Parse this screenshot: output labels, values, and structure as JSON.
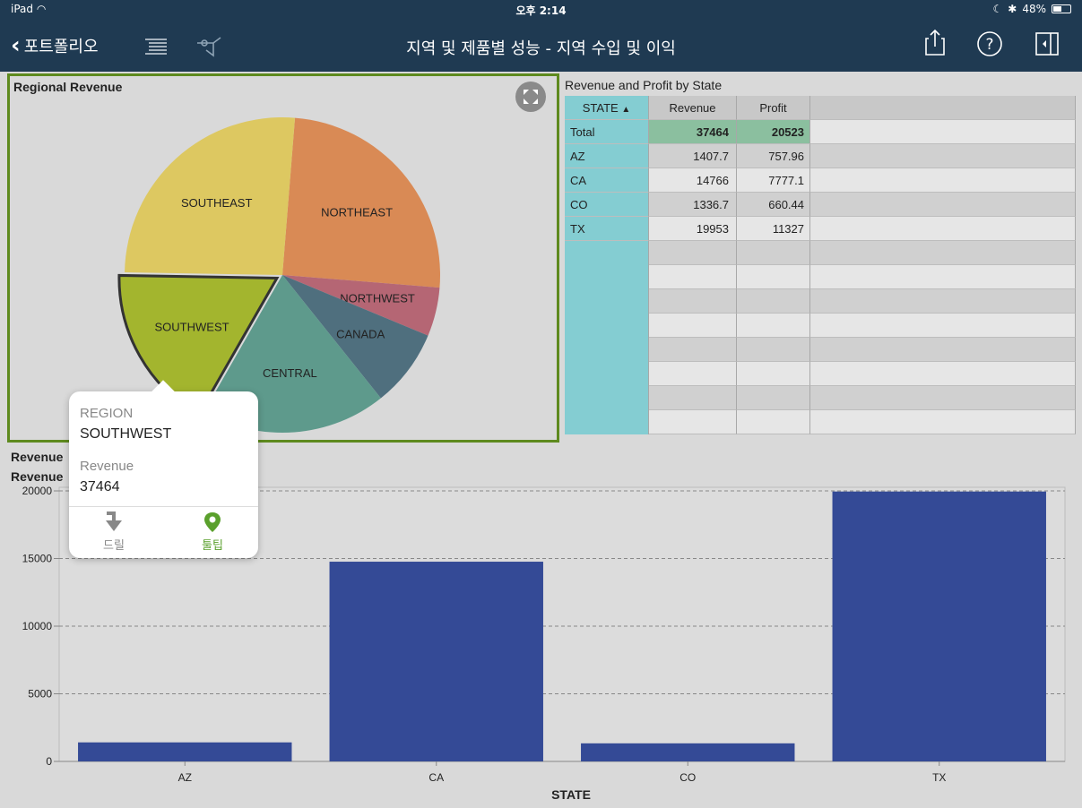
{
  "status_bar": {
    "device": "iPad",
    "time": "오후 2:14",
    "battery": "48%"
  },
  "nav": {
    "back_label": "포트폴리오",
    "title": "지역 및 제품별 성능 - 지역 수입 및 이익"
  },
  "pie_panel": {
    "title": "Regional Revenue",
    "chart_data": {
      "type": "pie",
      "title": "Regional Revenue",
      "slices": [
        {
          "label": "NORTHEAST",
          "value": 25,
          "color": "#d98a55"
        },
        {
          "label": "NORTHWEST",
          "value": 5,
          "color": "#b56674"
        },
        {
          "label": "CANADA",
          "value": 8,
          "color": "#4f6f7e"
        },
        {
          "label": "CENTRAL",
          "value": 19,
          "color": "#5e9a8c"
        },
        {
          "label": "SOUTHWEST",
          "value": 17,
          "color": "#a3b52e"
        },
        {
          "label": "SOUTHEAST",
          "value": 26,
          "color": "#ddc861"
        }
      ],
      "highlighted": "SOUTHWEST"
    }
  },
  "table_panel": {
    "title": "Revenue and Profit by State",
    "headers": {
      "state": "STATE",
      "revenue": "Revenue",
      "profit": "Profit"
    },
    "sort_indicator": "▲",
    "rows": [
      {
        "state": "Total",
        "revenue": "37464",
        "profit": "20523"
      },
      {
        "state": "AZ",
        "revenue": "1407.7",
        "profit": "757.96"
      },
      {
        "state": "CA",
        "revenue": "14766",
        "profit": "7777.1"
      },
      {
        "state": "CO",
        "revenue": "1336.7",
        "profit": "660.44"
      },
      {
        "state": "TX",
        "revenue": "19953",
        "profit": "11327"
      }
    ]
  },
  "bar_panel": {
    "title1": "Revenue",
    "title2": "Revenue",
    "chart_data": {
      "type": "bar",
      "categories": [
        "AZ",
        "CA",
        "CO",
        "TX"
      ],
      "values": [
        1407.7,
        14766,
        1336.7,
        19953
      ],
      "xlabel": "STATE",
      "ylim": [
        0,
        20000
      ],
      "yticks": [
        0,
        5000,
        10000,
        15000,
        20000
      ],
      "grid": true,
      "bar_color": "#344a96"
    }
  },
  "tooltip": {
    "label1": "REGION",
    "value1": "SOUTHWEST",
    "label2": "Revenue",
    "value2": "37464",
    "drill_label": "드릴",
    "tooltip_label": "툴팁",
    "active_color": "#5aa02c"
  }
}
